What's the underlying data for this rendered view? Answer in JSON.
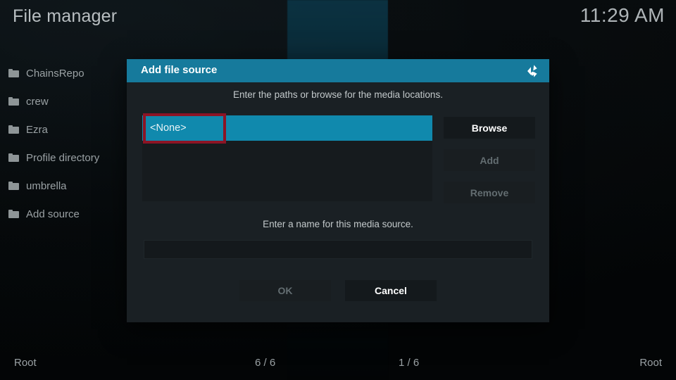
{
  "window": {
    "app_title": "File manager",
    "clock": "11:29 AM"
  },
  "sidebar": {
    "icon": "folder-icon",
    "items": [
      {
        "label": "ChainsRepo"
      },
      {
        "label": "crew"
      },
      {
        "label": "Ezra"
      },
      {
        "label": "Profile directory"
      },
      {
        "label": "umbrella"
      },
      {
        "label": "Add source"
      }
    ]
  },
  "dialog": {
    "title": "Add file source",
    "logo_icon": "kodi-logo-icon",
    "subtitle": "Enter the paths or browse for the media locations.",
    "path_list": [
      {
        "value": "<None>",
        "selected": true
      }
    ],
    "buttons": {
      "browse": "Browse",
      "add": "Add",
      "remove": "Remove"
    },
    "name_section": {
      "label": "Enter a name for this media source.",
      "value": "",
      "placeholder": ""
    },
    "footer": {
      "ok": "OK",
      "cancel": "Cancel"
    }
  },
  "statusbar": {
    "left": "Root",
    "left_count": "6 / 6",
    "right_count": "1 / 6",
    "right": "Root"
  },
  "colors": {
    "accent_teal": "#1089ad",
    "header_teal": "#167a9c",
    "annotation_red": "#8c1425",
    "panel_bg": "#1a2024",
    "listbox_bg": "#161b1e"
  }
}
